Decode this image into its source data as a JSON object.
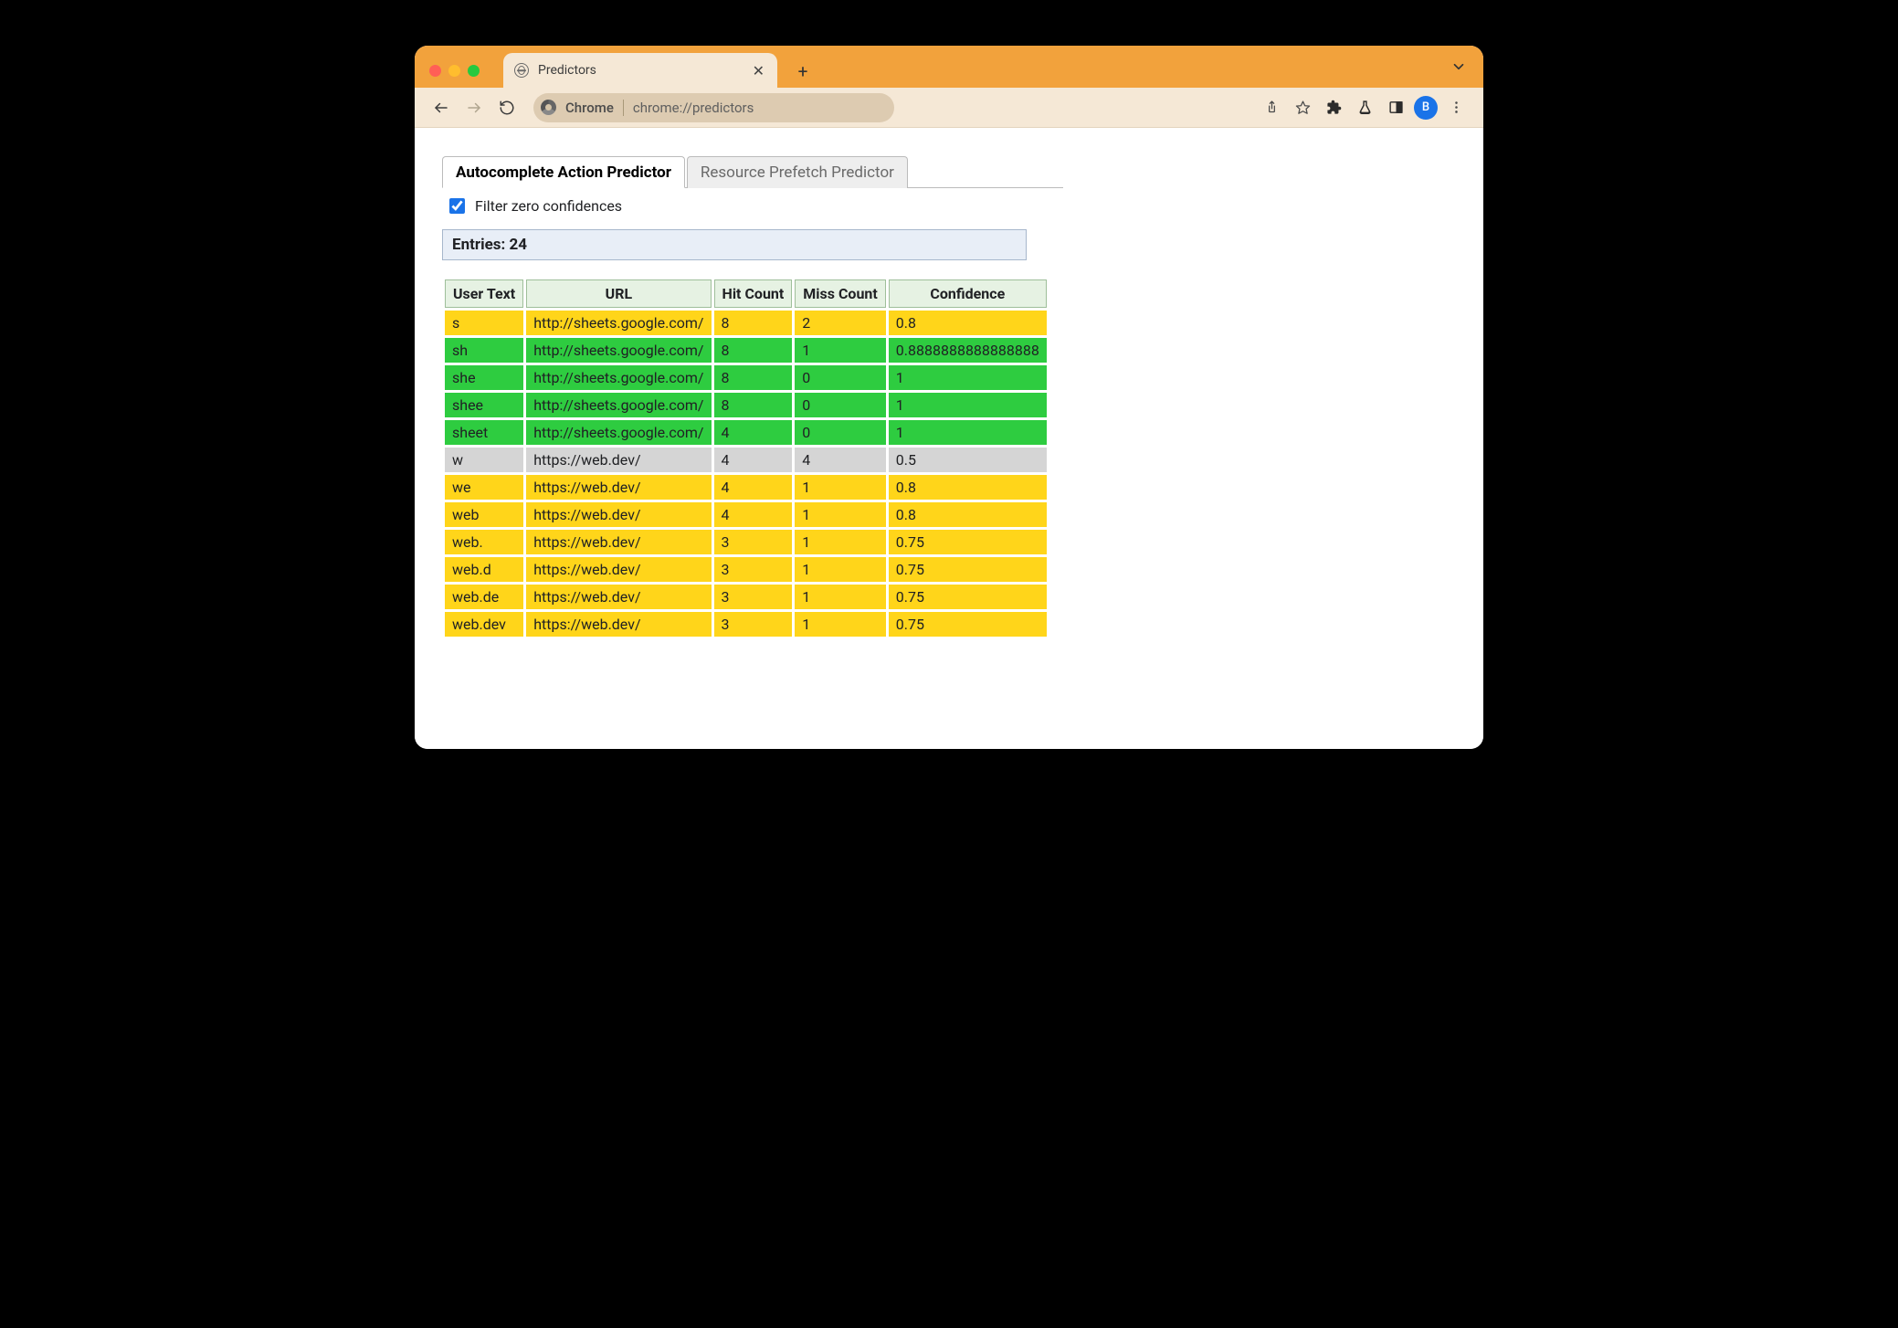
{
  "browser": {
    "tab_title": "Predictors",
    "address_label": "Chrome",
    "url": "chrome://predictors",
    "avatar_initial": "B"
  },
  "page": {
    "tabs": [
      {
        "label": "Autocomplete Action Predictor",
        "active": true
      },
      {
        "label": "Resource Prefetch Predictor",
        "active": false
      }
    ],
    "filter_label": "Filter zero confidences",
    "filter_checked": true,
    "entries_label": "Entries: 24",
    "columns": {
      "user_text": "User Text",
      "url": "URL",
      "hit": "Hit Count",
      "miss": "Miss Count",
      "confidence": "Confidence"
    },
    "rows": [
      {
        "user_text": "s",
        "url": "http://sheets.google.com/",
        "hit": "8",
        "miss": "2",
        "confidence": "0.8",
        "tone": "yellow"
      },
      {
        "user_text": "sh",
        "url": "http://sheets.google.com/",
        "hit": "8",
        "miss": "1",
        "confidence": "0.8888888888888888",
        "tone": "green"
      },
      {
        "user_text": "she",
        "url": "http://sheets.google.com/",
        "hit": "8",
        "miss": "0",
        "confidence": "1",
        "tone": "green"
      },
      {
        "user_text": "shee",
        "url": "http://sheets.google.com/",
        "hit": "8",
        "miss": "0",
        "confidence": "1",
        "tone": "green"
      },
      {
        "user_text": "sheet",
        "url": "http://sheets.google.com/",
        "hit": "4",
        "miss": "0",
        "confidence": "1",
        "tone": "green"
      },
      {
        "user_text": "w",
        "url": "https://web.dev/",
        "hit": "4",
        "miss": "4",
        "confidence": "0.5",
        "tone": "grey"
      },
      {
        "user_text": "we",
        "url": "https://web.dev/",
        "hit": "4",
        "miss": "1",
        "confidence": "0.8",
        "tone": "yellow"
      },
      {
        "user_text": "web",
        "url": "https://web.dev/",
        "hit": "4",
        "miss": "1",
        "confidence": "0.8",
        "tone": "yellow"
      },
      {
        "user_text": "web.",
        "url": "https://web.dev/",
        "hit": "3",
        "miss": "1",
        "confidence": "0.75",
        "tone": "yellow"
      },
      {
        "user_text": "web.d",
        "url": "https://web.dev/",
        "hit": "3",
        "miss": "1",
        "confidence": "0.75",
        "tone": "yellow"
      },
      {
        "user_text": "web.de",
        "url": "https://web.dev/",
        "hit": "3",
        "miss": "1",
        "confidence": "0.75",
        "tone": "yellow"
      },
      {
        "user_text": "web.dev",
        "url": "https://web.dev/",
        "hit": "3",
        "miss": "1",
        "confidence": "0.75",
        "tone": "yellow"
      }
    ]
  }
}
